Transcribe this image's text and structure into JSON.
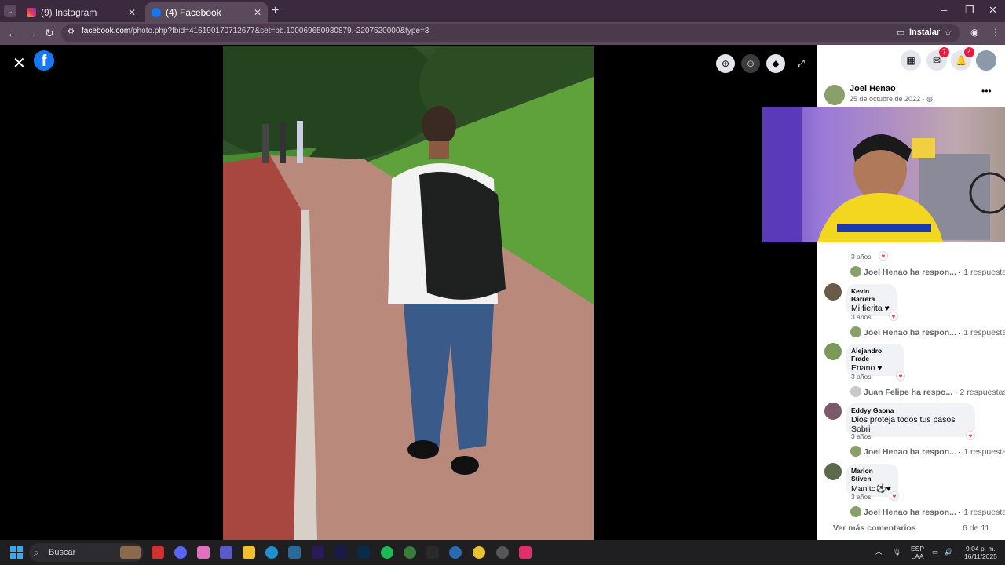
{
  "browser": {
    "tabs": [
      {
        "title": "(9) Instagram",
        "active": false
      },
      {
        "title": "(4) Facebook",
        "active": true
      }
    ],
    "url_domain": "facebook.com",
    "url_rest": "/photo.php?fbid=416190170712677&set=pb.100069650930879.-2207520000&type=3",
    "install_label": "Instalar"
  },
  "panel": {
    "notifications": {
      "messenger": "7",
      "bell": "4"
    },
    "author": {
      "name": "Joel Henao",
      "date": "25 de octubre de 2022 · "
    },
    "first_time": "3 años",
    "first_reply": {
      "text": "Joel Henao ha respon...",
      "count": "· 1 respuesta"
    },
    "comments": [
      {
        "name": "Kevin Barrera",
        "text": "Mi fierita ♥",
        "time": "3 años",
        "reply": "Joel Henao ha respon...",
        "count": "· 1 respuesta"
      },
      {
        "name": "Alejandro Frade",
        "text": "Enano ♥",
        "time": "3 años",
        "reply": "Juan Felipe ha respo...",
        "count": "· 2 respuestas"
      },
      {
        "name": "Eddyy Gaona",
        "text": "Dios proteja todos tus pasos Sobri",
        "time": "3 años",
        "reply": "Joel Henao ha respon...",
        "count": "· 1 respuesta"
      },
      {
        "name": "Marlon Stiven",
        "text": "Manito⚽♥",
        "time": "3 años",
        "reply": "Joel Henao ha respon...",
        "count": "· 1 respuesta"
      }
    ],
    "see_more": "Ver más comentarios",
    "page_count": "6 de 11"
  },
  "taskbar": {
    "search_placeholder": "Buscar",
    "language": "ESP",
    "layout": "LAA",
    "time": "9:04 p. m.",
    "date": "16/11/2025"
  }
}
